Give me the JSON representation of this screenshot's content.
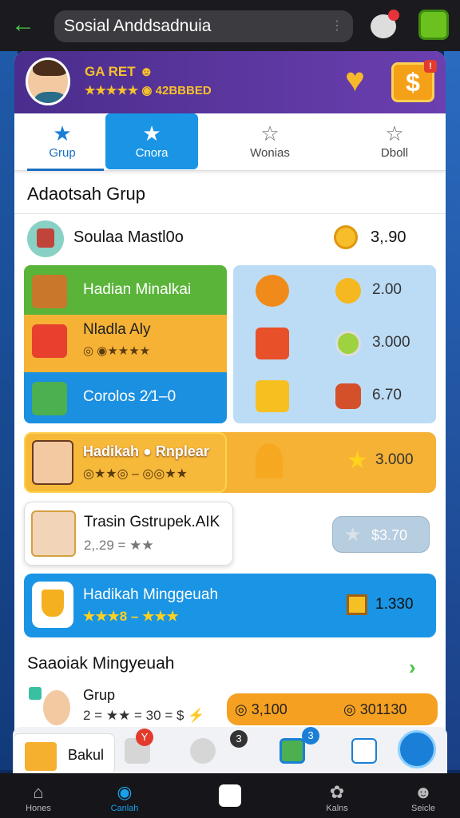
{
  "browser": {
    "url": "Sosial Anddsadnuia",
    "menu_dots": "⋮",
    "back_icon": "←"
  },
  "header": {
    "username": "GA RET ☻",
    "stats": "★★★★★ ◉ 42BBBED"
  },
  "tabs": [
    {
      "label": "Grup",
      "icon": "★"
    },
    {
      "label": "Cnora",
      "icon": "★"
    },
    {
      "label": "Wonias",
      "icon": "☆"
    },
    {
      "label": "Dboll",
      "icon": "☆"
    }
  ],
  "section1": {
    "title": "Adaotsah Grup",
    "top_row": {
      "label": "Soulaa Mastl0o",
      "value": "3,.90"
    }
  },
  "grid_left": [
    {
      "label": "Hadian Minalkai",
      "color": "#5ab43a"
    },
    {
      "label": "Nladla Aly",
      "sub": "◎ ◉★★★★",
      "color": "#f5b235"
    },
    {
      "label": "Corolos 2⁄1–0",
      "color": "#1b8fe0"
    }
  ],
  "grid_right": [
    {
      "value": "2.00"
    },
    {
      "value": "3.000"
    },
    {
      "value": "6.70"
    }
  ],
  "rowA": {
    "title": "Hadikah ● Rnplear",
    "sub": "◎★★◎ – ◎◎★★",
    "value": "3.000"
  },
  "rowB": {
    "title": "Trasin Gstrupek.AIK",
    "sub": "2,.29 = ★★"
  },
  "pill": {
    "value": "$3.70"
  },
  "rowC": {
    "title": "Hadikah Minggeuah",
    "sub": "★★★8 – ★★★",
    "value": "1.330"
  },
  "section2": {
    "title": "Saaoiak Mingyeuah",
    "chevron": "›",
    "row": {
      "title": "Grup",
      "sub": "2 = ★★ = 30 = $ ⚡",
      "a": "◎ 3,100",
      "b": "◎ 301130"
    }
  },
  "tray": {
    "book_label": "Bakul",
    "badges": [
      "Y",
      "3",
      "3"
    ]
  },
  "bottom_nav": [
    {
      "label": "Hones",
      "icon": "⌂"
    },
    {
      "label": "Canlah",
      "icon": "◉"
    },
    {
      "label": "Kalns",
      "icon": "✿"
    },
    {
      "label": "Seicle",
      "icon": "☻"
    }
  ]
}
